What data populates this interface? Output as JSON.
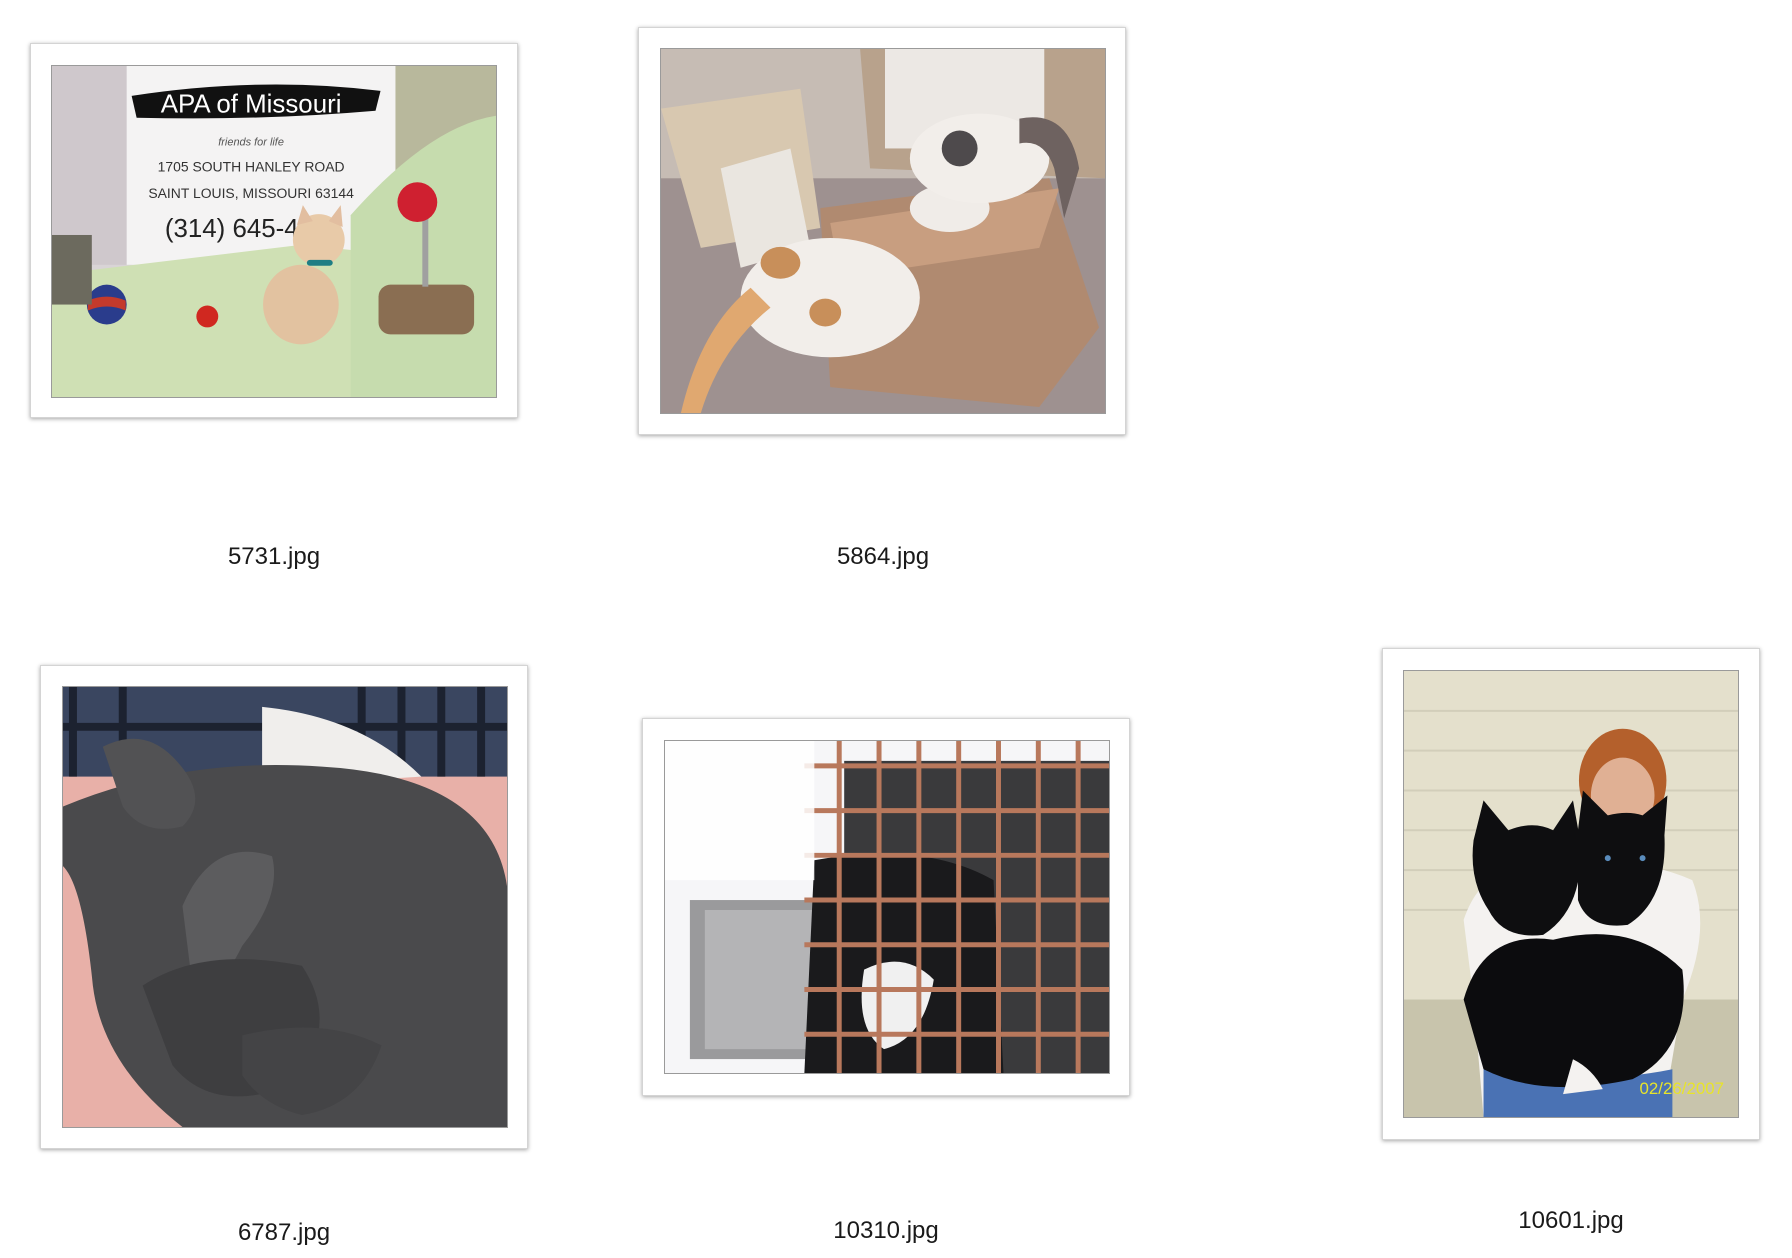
{
  "files": [
    {
      "filename": "5731.jpg",
      "photo": {
        "sign_title": "APA of Missouri",
        "sign_tagline": "friends for life",
        "sign_line1": "1705 SOUTH HANLEY ROAD",
        "sign_line2": "SAINT LOUIS, MISSOURI 63144",
        "sign_phone": "(314) 645-4  0"
      }
    },
    {
      "filename": "5864.jpg"
    },
    {
      "filename": "6787.jpg"
    },
    {
      "filename": "10310.jpg"
    },
    {
      "filename": "10601.jpg",
      "photo": {
        "date_stamp": "02/26/2007"
      }
    }
  ]
}
